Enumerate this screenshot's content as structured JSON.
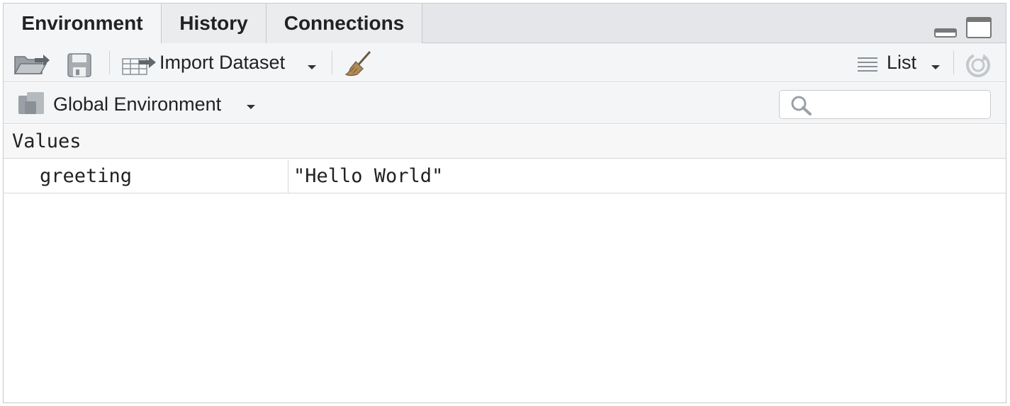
{
  "tabs": [
    {
      "label": "Environment",
      "active": true
    },
    {
      "label": "History",
      "active": false
    },
    {
      "label": "Connections",
      "active": false
    }
  ],
  "toolbar": {
    "open_icon": "folder-open-icon",
    "save_icon": "save-disk-icon",
    "import_label": "Import Dataset",
    "clear_icon": "broom-icon",
    "view_label": "List",
    "refresh_icon": "refresh-icon"
  },
  "environment": {
    "selected": "Global Environment",
    "search_placeholder": ""
  },
  "section_header": "Values",
  "rows": [
    {
      "name": "greeting",
      "value": "\"Hello World\""
    }
  ],
  "colors": {
    "tab_bg": "#e4e6e9",
    "toolbar_bg": "#f4f5f6",
    "border": "#d6d8db"
  }
}
